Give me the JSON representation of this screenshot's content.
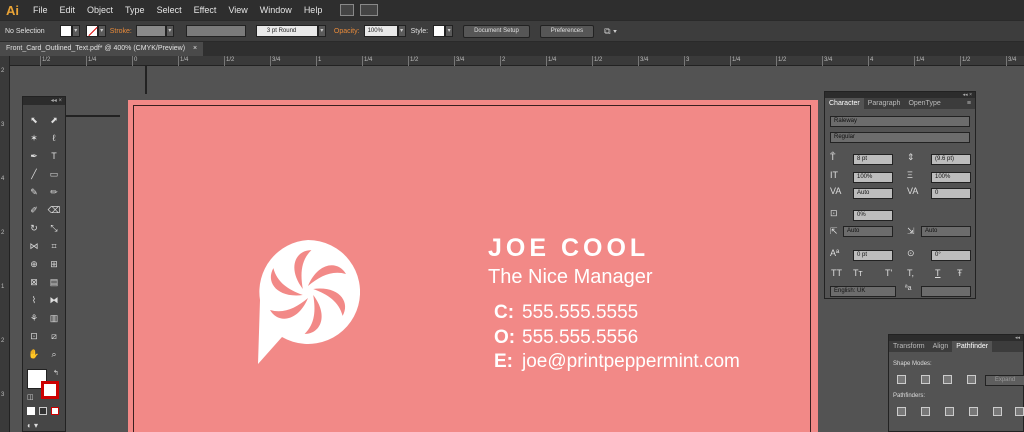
{
  "app": {
    "logo": "Ai"
  },
  "menu": [
    "File",
    "Edit",
    "Object",
    "Type",
    "Select",
    "Effect",
    "View",
    "Window",
    "Help"
  ],
  "control_bar": {
    "selection": "No Selection",
    "stroke_label": "Stroke:",
    "brush": "3 pt Round",
    "opacity_label": "Opacity:",
    "opacity_value": "100%",
    "style_label": "Style:",
    "document_setup": "Document Setup",
    "preferences": "Preferences"
  },
  "document_tab": "Front_Card_Outlined_Text.pdf* @ 400% (CMYK/Preview)",
  "ruler_labels": [
    "1/2",
    "1/4",
    "0",
    "1/4",
    "1/2",
    "3/4",
    "1",
    "1/4",
    "1/2",
    "3/4",
    "2",
    "1/4",
    "1/2",
    "3/4",
    "3",
    "1/4",
    "1/2",
    "3/4",
    "4",
    "1/4",
    "1/2",
    "3/4"
  ],
  "ruler_v_labels": [
    "2",
    "3",
    "4",
    "2",
    "1",
    "2",
    "3"
  ],
  "card": {
    "name": "JOE COOL",
    "title": "The Nice Manager",
    "contacts": [
      {
        "prefix": "C:",
        "value": "555.555.5555"
      },
      {
        "prefix": "O:",
        "value": "555.555.5556"
      },
      {
        "prefix": "E:",
        "value": "joe@printpeppermint.com"
      }
    ],
    "color": "#f28987"
  },
  "character_panel": {
    "tabs": [
      "Character",
      "Paragraph",
      "OpenType"
    ],
    "font": "Raleway",
    "style": "Regular",
    "size": "8 pt",
    "leading": "(9.6 pt)",
    "v_scale": "100%",
    "h_scale": "100%",
    "kerning": "Auto",
    "tracking": "0",
    "tsume": "0%",
    "aki_left": "Auto",
    "aki_right": "Auto",
    "baseline": "0 pt",
    "rotation": "0°",
    "language": "English: UK",
    "type_buttons": [
      "TT",
      "Tт",
      "T'",
      "T,",
      "T",
      "Ŧ"
    ]
  },
  "pathfinder_panel": {
    "tabs": [
      "Transform",
      "Align",
      "Pathfinder"
    ],
    "shape_modes": "Shape Modes:",
    "pathfinders": "Pathfinders:",
    "expand": "Expand"
  }
}
